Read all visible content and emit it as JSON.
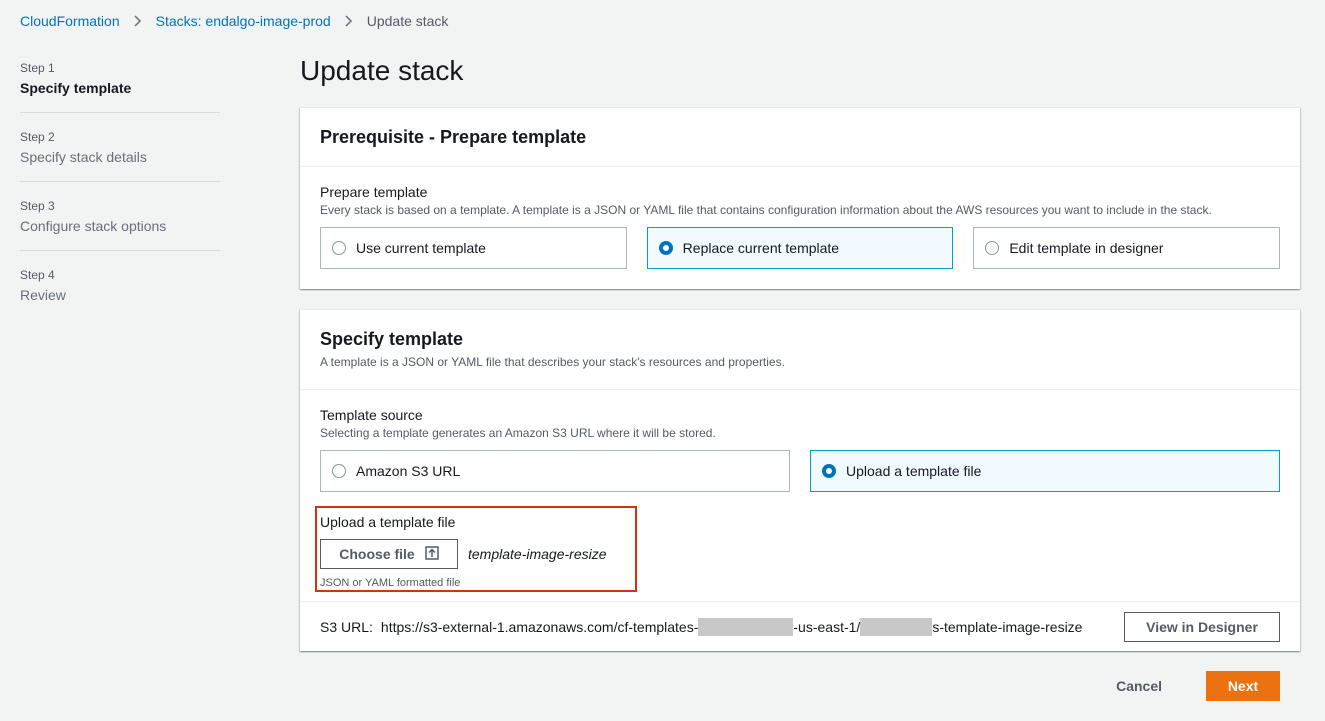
{
  "breadcrumb": {
    "root": "CloudFormation",
    "stacks": "Stacks: endalgo-image-prod",
    "current": "Update stack"
  },
  "steps": [
    {
      "num": "Step 1",
      "name": "Specify template"
    },
    {
      "num": "Step 2",
      "name": "Specify stack details"
    },
    {
      "num": "Step 3",
      "name": "Configure stack options"
    },
    {
      "num": "Step 4",
      "name": "Review"
    }
  ],
  "page_title": "Update stack",
  "prerequisite": {
    "title": "Prerequisite - Prepare template",
    "field_label": "Prepare template",
    "field_desc": "Every stack is based on a template. A template is a JSON or YAML file that contains configuration information about the AWS resources you want to include in the stack.",
    "options": [
      "Use current template",
      "Replace current template",
      "Edit template in designer"
    ],
    "selected": "Replace current template"
  },
  "specify": {
    "title": "Specify template",
    "desc": "A template is a JSON or YAML file that describes your stack's resources and properties.",
    "source_label": "Template source",
    "source_desc": "Selecting a template generates an Amazon S3 URL where it will be stored.",
    "options": [
      "Amazon S3 URL",
      "Upload a template file"
    ],
    "selected": "Upload a template file",
    "upload_label": "Upload a template file",
    "choose_file": "Choose file",
    "filename": "template-image-resize",
    "hint": "JSON or YAML formatted file",
    "s3_label": "S3 URL:",
    "s3_part1": "https://s3-external-1.amazonaws.com/cf-templates-",
    "s3_part2": "-us-east-1/",
    "s3_part3": "s-template-image-resize",
    "view_designer": "View in Designer"
  },
  "footer": {
    "cancel": "Cancel",
    "next": "Next"
  },
  "colors": {
    "link": "#0073bb",
    "primary_button": "#ec7211",
    "highlight_box": "#d13212",
    "selected_tile": "#f1faff"
  }
}
